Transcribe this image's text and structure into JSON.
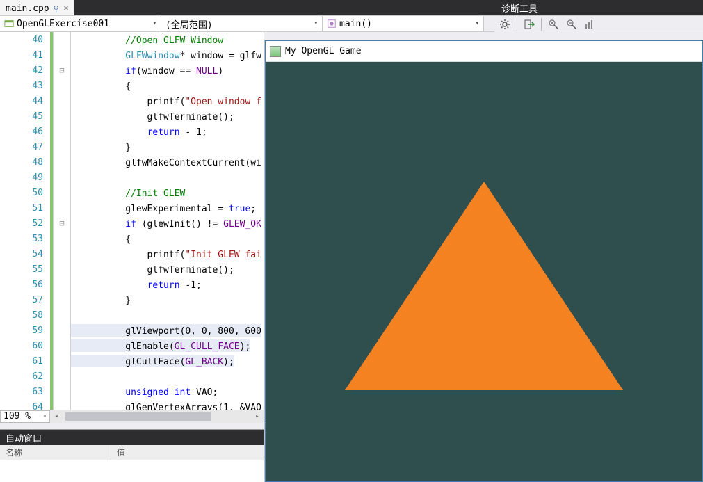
{
  "tabs": {
    "file": "main.cpp"
  },
  "diag": {
    "title": "诊断工具"
  },
  "nav": {
    "project_icon": "project-icon",
    "project": "OpenGLExercise001",
    "scope": "(全局范围)",
    "func_icon": "function-icon",
    "func": "main()"
  },
  "zoom": "109 %",
  "code": {
    "lines": [
      {
        "n": 40,
        "fold": "",
        "hl": false,
        "html": "<span class='tok-c'>//Open GLFW Window</span>"
      },
      {
        "n": 41,
        "fold": "",
        "hl": false,
        "html": "<span class='tok-t'>GLFWwindow</span><span class='tok-n'>* window = glfw</span>"
      },
      {
        "n": 42,
        "fold": "⊟",
        "hl": false,
        "html": "<span class='tok-k'>if</span><span class='tok-n'>(window == </span><span class='tok-m'>NULL</span><span class='tok-n'>)</span>"
      },
      {
        "n": 43,
        "fold": "",
        "hl": false,
        "html": "<span class='tok-n'>{</span>"
      },
      {
        "n": 44,
        "fold": "",
        "hl": false,
        "html": "<span class='tok-n'>    printf(</span><span class='tok-s'>\"Open window f</span>"
      },
      {
        "n": 45,
        "fold": "",
        "hl": false,
        "html": "<span class='tok-n'>    glfwTerminate();</span>"
      },
      {
        "n": 46,
        "fold": "",
        "hl": false,
        "html": "<span class='tok-n'>    </span><span class='tok-k'>return</span><span class='tok-n'> - 1;</span>"
      },
      {
        "n": 47,
        "fold": "",
        "hl": false,
        "html": "<span class='tok-n'>}</span>"
      },
      {
        "n": 48,
        "fold": "",
        "hl": false,
        "html": "<span class='tok-n'>glfwMakeContextCurrent(wi</span>"
      },
      {
        "n": 49,
        "fold": "",
        "hl": false,
        "html": ""
      },
      {
        "n": 50,
        "fold": "",
        "hl": false,
        "html": "<span class='tok-c'>//Init GLEW</span>"
      },
      {
        "n": 51,
        "fold": "",
        "hl": false,
        "html": "<span class='tok-n'>glewExperimental = </span><span class='tok-k'>true</span><span class='tok-n'>;</span>"
      },
      {
        "n": 52,
        "fold": "⊟",
        "hl": false,
        "html": "<span class='tok-k'>if</span><span class='tok-n'> (glewInit() != </span><span class='tok-m'>GLEW_OK</span>"
      },
      {
        "n": 53,
        "fold": "",
        "hl": false,
        "html": "<span class='tok-n'>{</span>"
      },
      {
        "n": 54,
        "fold": "",
        "hl": false,
        "html": "<span class='tok-n'>    printf(</span><span class='tok-s'>\"Init GLEW fai</span>"
      },
      {
        "n": 55,
        "fold": "",
        "hl": false,
        "html": "<span class='tok-n'>    glfwTerminate();</span>"
      },
      {
        "n": 56,
        "fold": "",
        "hl": false,
        "html": "<span class='tok-n'>    </span><span class='tok-k'>return</span><span class='tok-n'> -1;</span>"
      },
      {
        "n": 57,
        "fold": "",
        "hl": false,
        "html": "<span class='tok-n'>}</span>"
      },
      {
        "n": 58,
        "fold": "",
        "hl": false,
        "html": ""
      },
      {
        "n": 59,
        "fold": "",
        "hl": true,
        "html": "<span class='tok-n'>glViewport(0, 0, 800, 600</span>"
      },
      {
        "n": 60,
        "fold": "",
        "hl": true,
        "html": "<span class='tok-n'>glEnable(</span><span class='tok-m'>GL_CULL_FACE</span><span class='tok-n'>);</span>"
      },
      {
        "n": 61,
        "fold": "",
        "hl": true,
        "html": "<span class='tok-n'>glCullFace(</span><span class='tok-m'>GL_BACK</span><span class='tok-n'>);</span>"
      },
      {
        "n": 62,
        "fold": "",
        "hl": false,
        "html": ""
      },
      {
        "n": 63,
        "fold": "",
        "hl": false,
        "html": "<span class='tok-k'>unsigned</span><span class='tok-n'> </span><span class='tok-k'>int</span><span class='tok-n'> VAO;</span>"
      },
      {
        "n": 64,
        "fold": "",
        "hl": false,
        "html": "<span class='tok-n'>glGenVertexArrays(1, &amp;VAO</span>"
      }
    ],
    "indent_base": "        "
  },
  "autos": {
    "title": "自动窗口",
    "col_name": "名称",
    "col_value": "值"
  },
  "appwin": {
    "title": "My OpenGL Game",
    "bg": "#2f4f4f",
    "triangle_color": "#f58220"
  }
}
